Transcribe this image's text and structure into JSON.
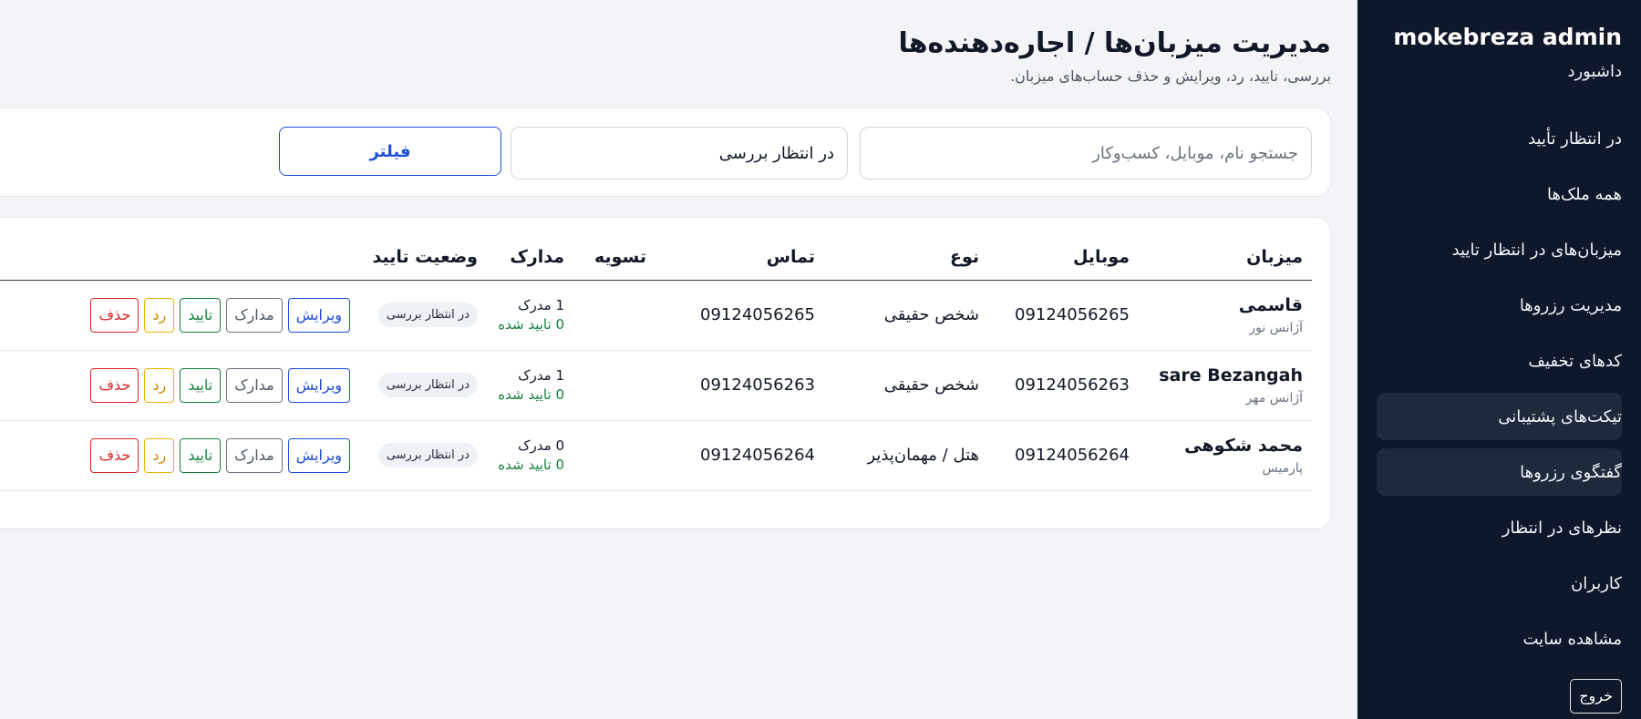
{
  "sidebar": {
    "brand": "mokebreza admin",
    "items": [
      {
        "label": "داشبورد"
      },
      {
        "label": "در انتظار تأیید"
      },
      {
        "label": "همه ملک‌ها"
      },
      {
        "label": "میزبان‌های در انتظار تایید"
      },
      {
        "label": "مدیریت رزروها"
      },
      {
        "label": "کدهای تخفیف"
      },
      {
        "label": "تیکت‌های پشتیبانی"
      },
      {
        "label": "گفتگوی رزروها"
      },
      {
        "label": "نظرهای در انتظار"
      },
      {
        "label": "کاربران"
      },
      {
        "label": "مشاهده سایت"
      }
    ],
    "logout_label": "خروج"
  },
  "header": {
    "title": "مدیریت میزبان‌ها / اجاره‌دهنده‌ها",
    "subtitle": "بررسی، تایید، رد، ویرایش و حذف حساب‌های میزبان."
  },
  "filters": {
    "search_placeholder": "جستجو نام، موبایل، کسب‌وکار",
    "status_selected": "در انتظار بررسی",
    "filter_label": "فیلتر"
  },
  "table": {
    "headers": {
      "host": "میزبان",
      "mobile": "موبایل",
      "type": "نوع",
      "contact": "تماس",
      "settlement": "تسویه",
      "documents": "مدارک",
      "status": "وضعیت تایید"
    },
    "actions": {
      "edit": "ویرایش",
      "docs": "مدارک",
      "approve": "تایید",
      "reject": "رد",
      "delete": "حذف"
    },
    "rows": [
      {
        "name": "قاسمی",
        "business": "آژانس نور",
        "mobile": "09124056265",
        "type": "شخص حقیقی",
        "contact": "09124056265",
        "settlement": "",
        "docs_count": "1 مدرک",
        "docs_verified": "0 تایید شده",
        "status": "در انتظار بررسی"
      },
      {
        "name": "sare Bezangah",
        "business": "آژانس مهر",
        "mobile": "09124056263",
        "type": "شخص حقیقی",
        "contact": "09124056263",
        "settlement": "",
        "docs_count": "1 مدرک",
        "docs_verified": "0 تایید شده",
        "status": "در انتظار بررسی"
      },
      {
        "name": "محمد شکوهی",
        "business": "پارمیس",
        "mobile": "09124056264",
        "type": "هتل / مهمان‌پذیر",
        "contact": "09124056264",
        "settlement": "",
        "docs_count": "0 مدرک",
        "docs_verified": "0 تایید شده",
        "status": "در انتظار بررسی"
      }
    ]
  }
}
